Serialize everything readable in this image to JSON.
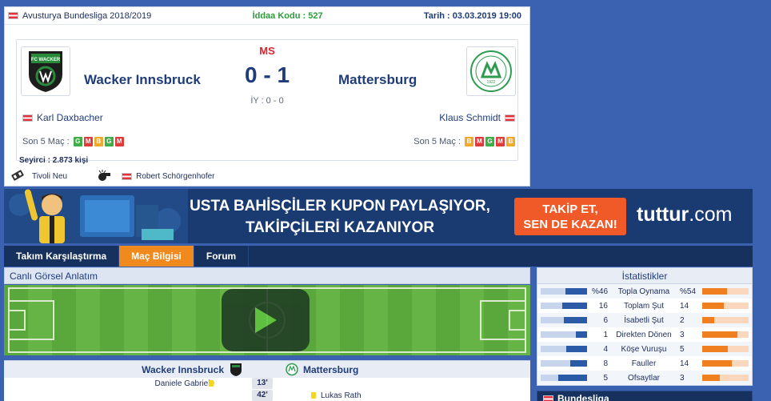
{
  "header": {
    "league": "Avusturya Bundesliga 2018/2019",
    "iddaa_code": "İddaa Kodu : 527",
    "date": "Tarih : 03.03.2019 19:00"
  },
  "match": {
    "status": "MS",
    "score": "0 - 1",
    "halftime": "İY : 0 - 0",
    "home": {
      "name": "Wacker Innsbruck",
      "coach": "Karl Daxbacher",
      "form_label": "Son 5 Maç :",
      "form": [
        "G",
        "M",
        "B",
        "G",
        "M"
      ],
      "logo_text": "FC WACKER"
    },
    "away": {
      "name": "Mattersburg",
      "coach": "Klaus Schmidt",
      "form_label": "Son 5 Maç :",
      "form": [
        "B",
        "M",
        "G",
        "M",
        "B"
      ],
      "logo_text": "SVM"
    },
    "spectators": "Seyirci : 2.873 kişi",
    "venue": "Tivoli Neu",
    "referee": "Robert Schörgenhofer"
  },
  "banner": {
    "line1": "USTA BAHİSÇİLER KUPON PAYLAŞIYOR,",
    "line2": "TAKİPÇİLERİ KAZANIYOR",
    "cta_line1": "TAKİP ET,",
    "cta_line2": "SEN DE KAZAN!",
    "brand": "tuttur",
    "brand_suffix": ".com"
  },
  "tabs": [
    {
      "label": "Takım Karşılaştırma",
      "active": false
    },
    {
      "label": "Maç Bilgisi",
      "active": true
    },
    {
      "label": "Forum",
      "active": false
    }
  ],
  "live": {
    "title": "Canlı Görsel Anlatım"
  },
  "events": {
    "home_team": "Wacker Innsbruck",
    "away_team": "Mattersburg",
    "rows": [
      {
        "minute": "13'",
        "home_player": "Daniele Gabriele",
        "away_player": "",
        "card": "yellow"
      },
      {
        "minute": "42'",
        "home_player": "",
        "away_player": "Lukas Rath",
        "card": "yellow"
      }
    ]
  },
  "stats": {
    "title": "İstatistikler",
    "rows": [
      {
        "label": "Topla Oynama",
        "home": "%46",
        "away": "%54",
        "home_frac": 0.46,
        "away_frac": 0.54
      },
      {
        "label": "Toplam Şut",
        "home": "16",
        "away": "14",
        "home_frac": 0.53,
        "away_frac": 0.47
      },
      {
        "label": "İsabetli Şut",
        "home": "6",
        "away": "2",
        "home_frac": 0.5,
        "away_frac": 0.25
      },
      {
        "label": "Direkten Dönen",
        "home": "1",
        "away": "3",
        "home_frac": 0.25,
        "away_frac": 0.75
      },
      {
        "label": "Köşe Vuruşu",
        "home": "4",
        "away": "5",
        "home_frac": 0.44,
        "away_frac": 0.56
      },
      {
        "label": "Fauller",
        "home": "8",
        "away": "14",
        "home_frac": 0.36,
        "away_frac": 0.64
      },
      {
        "label": "Ofsaytlar",
        "home": "5",
        "away": "3",
        "home_frac": 0.62,
        "away_frac": 0.38
      }
    ]
  },
  "league_box": {
    "title": "Bundesliga"
  },
  "colors": {
    "page_bg": "#3a62b0",
    "navy": "#1f3d7a",
    "accent_orange": "#f08a1f",
    "win": "#3fae49",
    "loss": "#e03b3b",
    "draw": "#f0a92a",
    "live_red": "#d9232d",
    "code_green": "#2e9b3f"
  }
}
